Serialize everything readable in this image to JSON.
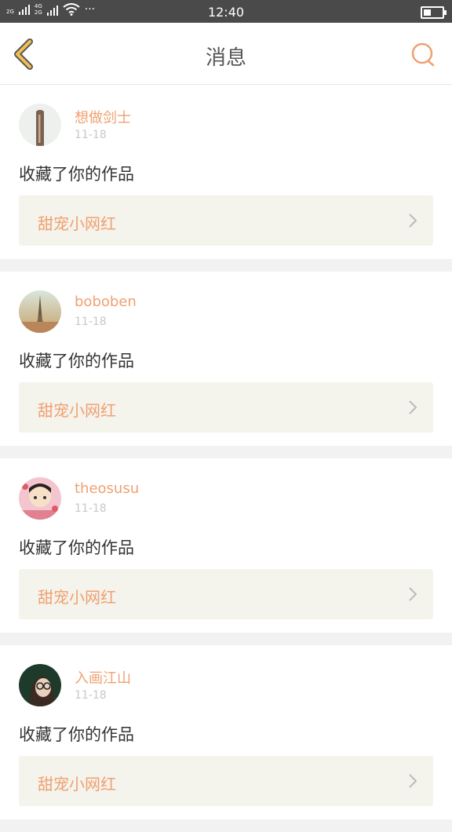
{
  "status_bar": {
    "network_1": "2G",
    "network_2a": "4G",
    "network_2b": "2G",
    "more": "···",
    "time": "12:40"
  },
  "header": {
    "title": "消息",
    "back_icon": "chevron-left-icon",
    "search_icon": "search-icon",
    "accent_color": "#f0b060"
  },
  "messages": [
    {
      "username": "想做剑士",
      "date": "11-18",
      "action": "收藏了你的作品",
      "work_title": "甜宠小网红"
    },
    {
      "username": "boboben",
      "date": "11-18",
      "action": "收藏了你的作品",
      "work_title": "甜宠小网红"
    },
    {
      "username": "theosusu",
      "date": "11-18",
      "action": "收藏了你的作品",
      "work_title": "甜宠小网红"
    },
    {
      "username": "入画江山",
      "date": "11-18",
      "action": "收藏了你的作品",
      "work_title": "甜宠小网红"
    }
  ],
  "colors": {
    "username": "#f0a070",
    "work_bg": "#f4f3ec",
    "page_bg": "#f2f2f2"
  }
}
